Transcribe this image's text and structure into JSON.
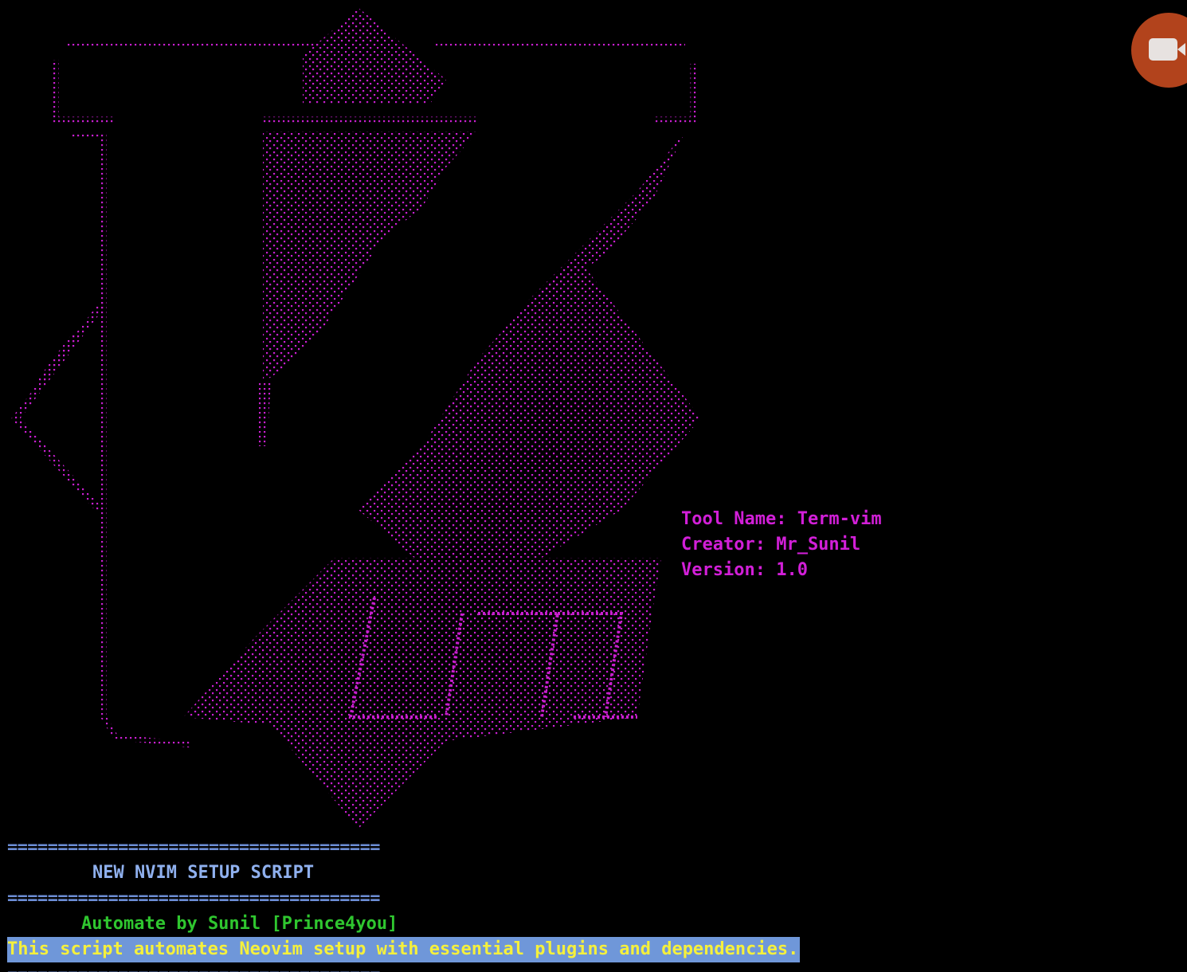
{
  "logo": {
    "alt": "Vim ASCII art logo",
    "color": "#c81fcf"
  },
  "info": {
    "tool_name": "Tool Name: Term-vim",
    "creator": "Creator: Mr_Sunil",
    "version": "Version: 1.0"
  },
  "banner": {
    "separator": "=====================================",
    "title": "NEW NVIM SETUP SCRIPT",
    "author": "Automate by Sunil [Prince4you]",
    "description": "This script automates Neovim setup with essential plugins and dependencies."
  },
  "colors": {
    "background": "#000000",
    "magenta": "#d21fd8",
    "separator_blue": "#6d8ed6",
    "title_blue": "#8fb0ee",
    "author_green": "#2fc62f",
    "desc_yellow": "#f5f03c",
    "desc_highlight": "#6f97d9",
    "record_button": "#b2431c"
  },
  "icons": {
    "record": "video-camera-icon"
  }
}
